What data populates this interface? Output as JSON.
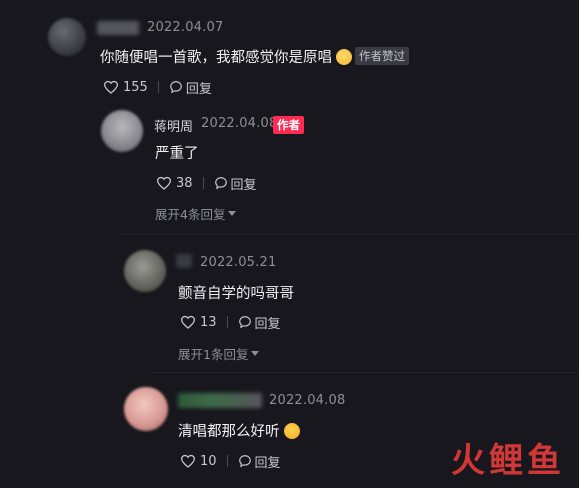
{
  "comments": [
    {
      "date": "2022.04.07",
      "text": "你随便唱一首歌，我都感觉你是原唱",
      "badge": "作者赞过",
      "likes": "155",
      "reply_label": "回复"
    },
    {
      "name": "蒋明周",
      "date": "2022.04.08",
      "badge": "作者",
      "text": "严重了",
      "likes": "38",
      "reply_label": "回复",
      "expand": "展开4条回复"
    },
    {
      "date": "2022.05.21",
      "text": "颤音自学的吗哥哥",
      "likes": "13",
      "reply_label": "回复",
      "expand": "展开1条回复"
    },
    {
      "date": "2022.04.08",
      "text": "清唱都那么好听",
      "likes": "10",
      "reply_label": "回复"
    }
  ],
  "watermark": {
    "logo_text": "火鲤鱼"
  },
  "colors": {
    "background": "#17171d",
    "author_badge": "#fe2c55",
    "liked_badge": "#3a3a42",
    "date_text": "#8e8e96"
  },
  "icons": {
    "like": "heart-icon",
    "reply": "comment-bubble-icon",
    "expand": "chevron-down-icon"
  }
}
